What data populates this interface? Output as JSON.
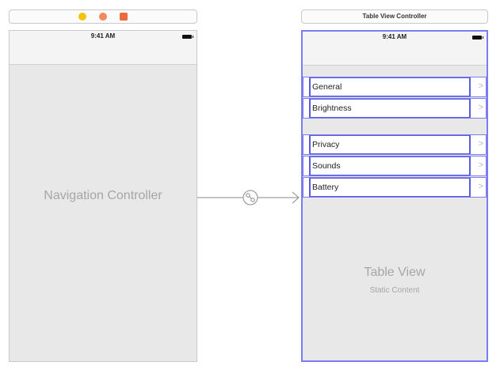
{
  "navigation_scene": {
    "dock_icons": [
      {
        "name": "view-controller-icon",
        "color": "#f1c40f"
      },
      {
        "name": "first-responder-icon",
        "color": "#f08a5d"
      },
      {
        "name": "exit-icon",
        "color": "#e96a3a"
      }
    ],
    "status_time": "9:41 AM",
    "placeholder": "Navigation Controller"
  },
  "table_scene": {
    "title": "Table View Controller",
    "status_time": "9:41 AM",
    "sections": [
      {
        "cells": [
          {
            "label": "General"
          },
          {
            "label": "Brightness"
          }
        ]
      },
      {
        "cells": [
          {
            "label": "Privacy"
          },
          {
            "label": "Sounds"
          },
          {
            "label": "Battery"
          }
        ]
      }
    ],
    "placeholder_title": "Table View",
    "placeholder_subtitle": "Static Content"
  },
  "segue": {
    "type": "root-view-controller-relationship",
    "icon": "relationship-icon"
  },
  "colors": {
    "selection": "#7c7cf2",
    "cell_border": "#5b5be0",
    "placeholder_text": "#a6a6a6"
  }
}
